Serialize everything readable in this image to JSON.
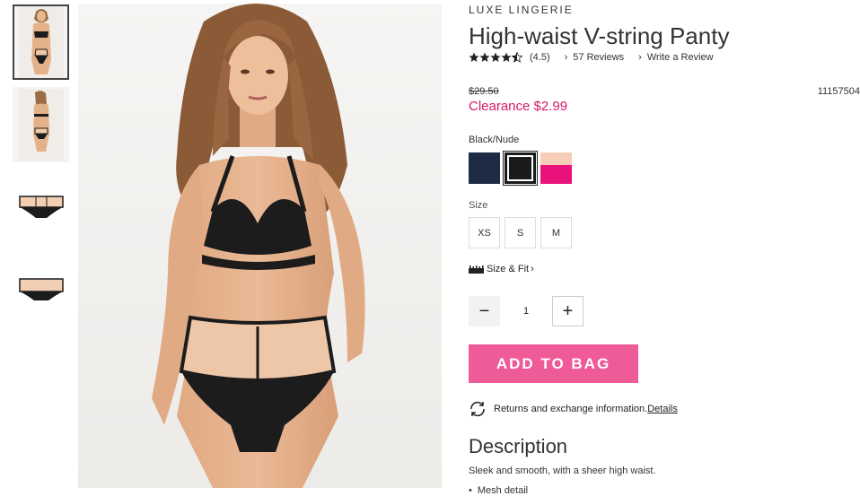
{
  "thumbnails": [
    {
      "name": "thumbnail-model-front",
      "selected": true
    },
    {
      "name": "thumbnail-model-back",
      "selected": false
    },
    {
      "name": "thumbnail-panty-front",
      "selected": false
    },
    {
      "name": "thumbnail-panty-back",
      "selected": false
    }
  ],
  "product": {
    "brand": "LUXE LINGERIE",
    "title": "High-waist V-string Panty",
    "rating_value": 4.5,
    "rating_text": "(4.5)",
    "reviews_label": "57 Reviews",
    "write_review_label": "Write a Review",
    "original_price": "$29.50",
    "sale_price": "Clearance $2.99",
    "sku": "11157504"
  },
  "color": {
    "selected_label": "Black/Nude",
    "swatches": [
      {
        "name": "swatch-navy",
        "color": "#1f2a44"
      },
      {
        "name": "swatch-black-nude",
        "color": "#1a1a1a",
        "selected": true
      },
      {
        "name": "swatch-nude-pink",
        "top": "#f6cdb6",
        "bottom": "#e8127a"
      }
    ]
  },
  "size": {
    "label": "Size",
    "options": [
      "XS",
      "S",
      "M"
    ]
  },
  "size_fit_label": "Size & Fit",
  "quantity": {
    "value": "1",
    "minus": "−",
    "plus": "+"
  },
  "add_to_bag_label": "ADD TO BAG",
  "returns": {
    "text": "Returns and exchange information.",
    "link": "Details"
  },
  "description": {
    "heading": "Description",
    "text": "Sleek and smooth, with a sheer high waist.",
    "bullets": [
      "Mesh detail"
    ]
  },
  "colors": {
    "accent_pink": "#ef5a98",
    "clearance_red": "#d6176b"
  }
}
